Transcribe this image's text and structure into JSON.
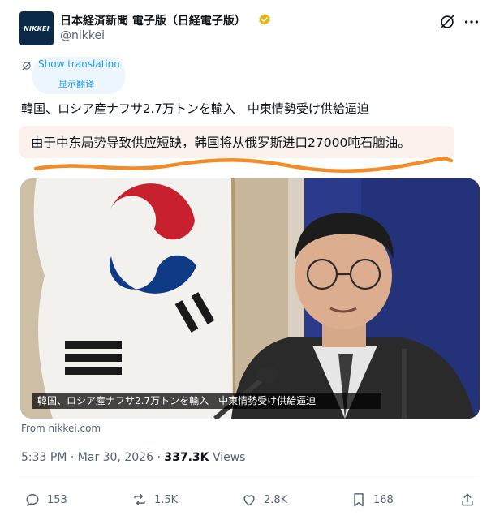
{
  "account": {
    "avatar_text": "NIKKEI",
    "display_name": "日本経済新聞 電子版（日経電子版）",
    "handle": "@nikkei",
    "verified": true
  },
  "translation": {
    "show_label": "Show translation",
    "show_label_cn": "显示翻译"
  },
  "post": {
    "headline": "韓国、ロシア産ナフサ2.7万トンを輸入　中東情勢受け供給逼迫",
    "chinese_translation": "由于中东局势导致供应短缺，韩国将从俄罗斯进口27000吨石脑油。",
    "image_caption": "韓国、ロシア産ナフサ2.7万トンを輸入　中東情勢受け供給逼迫",
    "source": "From nikkei.com"
  },
  "meta": {
    "time": "5:33 PM",
    "separator": "·",
    "date": "Mar 30, 2026",
    "views_count": "337.3K",
    "views_label": "Views"
  },
  "actions": {
    "replies": "153",
    "reposts": "1.5K",
    "likes": "2.8K",
    "bookmarks": "168"
  },
  "colors": {
    "link_blue": "#1d9bf0",
    "secondary_text": "#536471",
    "verified_gold": "#e2b719",
    "highlight_bg": "#fbf1ec",
    "scribble_orange": "#f28c28"
  },
  "icons": [
    "grok-icon",
    "more-icon",
    "translate-icon",
    "reply-icon",
    "repost-icon",
    "like-icon",
    "bookmark-icon",
    "share-icon"
  ]
}
